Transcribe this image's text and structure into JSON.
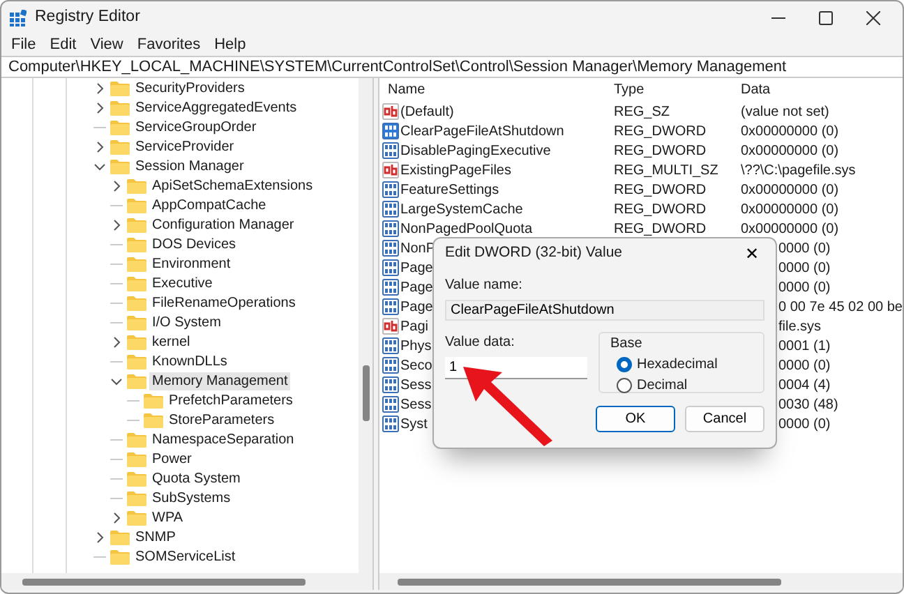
{
  "window": {
    "title": "Registry Editor"
  },
  "menu": [
    "File",
    "Edit",
    "View",
    "Favorites",
    "Help"
  ],
  "address": "Computer\\HKEY_LOCAL_MACHINE\\SYSTEM\\CurrentControlSet\\Control\\Session Manager\\Memory Management",
  "tree": {
    "items": [
      {
        "label": "SecurityProviders",
        "kind": "branch",
        "expanded": false,
        "selected": false
      },
      {
        "label": "ServiceAggregatedEvents",
        "kind": "branch",
        "expanded": false,
        "selected": false
      },
      {
        "label": "ServiceGroupOrder",
        "kind": "leaf",
        "selected": false
      },
      {
        "label": "ServiceProvider",
        "kind": "branch",
        "expanded": false,
        "selected": false
      },
      {
        "label": "Session Manager",
        "kind": "branch",
        "expanded": true,
        "selected": false,
        "children": [
          {
            "label": "ApiSetSchemaExtensions",
            "kind": "branch",
            "expanded": false,
            "selected": false
          },
          {
            "label": "AppCompatCache",
            "kind": "leaf",
            "selected": false
          },
          {
            "label": "Configuration Manager",
            "kind": "branch",
            "expanded": false,
            "selected": false
          },
          {
            "label": "DOS Devices",
            "kind": "leaf",
            "selected": false
          },
          {
            "label": "Environment",
            "kind": "leaf",
            "selected": false
          },
          {
            "label": "Executive",
            "kind": "leaf",
            "selected": false
          },
          {
            "label": "FileRenameOperations",
            "kind": "leaf",
            "selected": false
          },
          {
            "label": "I/O System",
            "kind": "leaf",
            "selected": false
          },
          {
            "label": "kernel",
            "kind": "branch",
            "expanded": false,
            "selected": false
          },
          {
            "label": "KnownDLLs",
            "kind": "leaf",
            "selected": false
          },
          {
            "label": "Memory Management",
            "kind": "branch",
            "expanded": true,
            "selected": true,
            "children": [
              {
                "label": "PrefetchParameters",
                "kind": "leaf",
                "selected": false
              },
              {
                "label": "StoreParameters",
                "kind": "leaf",
                "selected": false
              }
            ]
          },
          {
            "label": "NamespaceSeparation",
            "kind": "leaf",
            "selected": false
          },
          {
            "label": "Power",
            "kind": "leaf",
            "selected": false
          },
          {
            "label": "Quota System",
            "kind": "leaf",
            "selected": false
          },
          {
            "label": "SubSystems",
            "kind": "leaf",
            "selected": false
          },
          {
            "label": "WPA",
            "kind": "branch",
            "expanded": false,
            "selected": false
          }
        ]
      },
      {
        "label": "SNMP",
        "kind": "branch",
        "expanded": false,
        "selected": false
      },
      {
        "label": "SOMServiceList",
        "kind": "leaf",
        "selected": false
      }
    ]
  },
  "values": {
    "columns": [
      "Name",
      "Type",
      "Data"
    ],
    "rows": [
      {
        "kind": "string",
        "name": "(Default)",
        "type": "REG_SZ",
        "data": "(value not set)",
        "selected": false
      },
      {
        "kind": "dword",
        "name": "ClearPageFileAtShutdown",
        "type": "REG_DWORD",
        "data": "0x00000000 (0)",
        "selected": true
      },
      {
        "kind": "dword",
        "name": "DisablePagingExecutive",
        "type": "REG_DWORD",
        "data": "0x00000000 (0)",
        "selected": false
      },
      {
        "kind": "string",
        "name": "ExistingPageFiles",
        "type": "REG_MULTI_SZ",
        "data": "\\??\\C:\\pagefile.sys",
        "selected": false
      },
      {
        "kind": "dword",
        "name": "FeatureSettings",
        "type": "REG_DWORD",
        "data": "0x00000000 (0)",
        "selected": false
      },
      {
        "kind": "dword",
        "name": "LargeSystemCache",
        "type": "REG_DWORD",
        "data": "0x00000000 (0)",
        "selected": false
      },
      {
        "kind": "dword",
        "name": "NonPagedPoolQuota",
        "type": "REG_DWORD",
        "data": "0x00000000 (0)",
        "selected": false
      },
      {
        "kind": "dword",
        "name": "NonP",
        "data": "0000 (0)",
        "selected": false
      },
      {
        "kind": "dword",
        "name": "Page",
        "data": "0000 (0)",
        "selected": false
      },
      {
        "kind": "dword",
        "name": "Page",
        "data": "0000 (0)",
        "selected": false
      },
      {
        "kind": "dword",
        "name": "Page",
        "data": "0 00 7e 45 02 00 be",
        "selected": false
      },
      {
        "kind": "string",
        "name": "Pagi",
        "data": "file.sys",
        "selected": false
      },
      {
        "kind": "dword",
        "name": "Phys",
        "data": "0001 (1)",
        "selected": false
      },
      {
        "kind": "dword",
        "name": "Seco",
        "data": "0000 (0)",
        "selected": false
      },
      {
        "kind": "dword",
        "name": "Sess",
        "data": "0004 (4)",
        "selected": false
      },
      {
        "kind": "dword",
        "name": "Sess",
        "data": "0030 (48)",
        "selected": false
      },
      {
        "kind": "dword",
        "name": "Syst",
        "data": "0000 (0)",
        "selected": false
      }
    ]
  },
  "dialog": {
    "title": "Edit DWORD (32-bit) Value",
    "close": "✕",
    "value_name_label": "Value name:",
    "value_name": "ClearPageFileAtShutdown",
    "value_data_label": "Value data:",
    "value_data": "1",
    "base_label": "Base",
    "bases": [
      {
        "label": "Hexadecimal",
        "selected": true
      },
      {
        "label": "Decimal",
        "selected": false
      }
    ],
    "buttons": [
      "OK",
      "Cancel"
    ]
  }
}
